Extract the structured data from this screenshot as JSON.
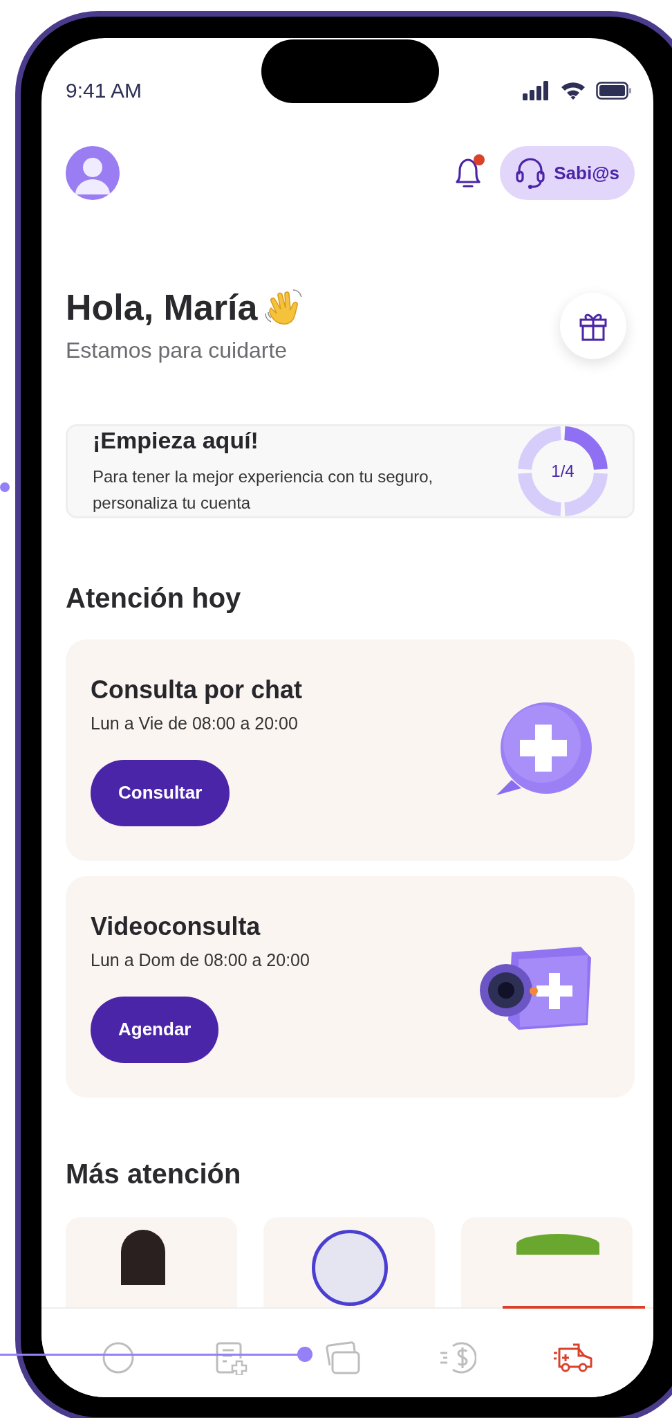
{
  "status_bar": {
    "time": "9:41 AM"
  },
  "header": {
    "notifications": {
      "unread": true
    },
    "support_button": {
      "label": "Sabi@s"
    }
  },
  "greeting": {
    "title": "Hola, María",
    "subtitle": "Estamos para cuidarte"
  },
  "onboarding_card": {
    "title": "¡Empieza aquí!",
    "text": "Para tener la mejor experiencia con tu seguro, personaliza tu cuenta",
    "progress": {
      "label": "1/4",
      "level": 0.25
    }
  },
  "today_section": {
    "title": "Atención hoy",
    "cards": [
      {
        "kind": "chat",
        "title": "Consulta por chat",
        "hours": "Lun a Vie de 08:00 a 20:00",
        "button": "Consultar"
      },
      {
        "kind": "video",
        "title": "Videoconsulta",
        "hours": "Lun a Dom de 08:00 a 20:00",
        "button": "Agendar"
      }
    ]
  },
  "more_section": {
    "title": "Más atención",
    "cards": [
      {
        "kind": "person"
      },
      {
        "kind": "ring"
      },
      {
        "kind": "leaves"
      }
    ]
  },
  "bottom_nav": [
    {
      "kind": "circle",
      "selected": false
    },
    {
      "kind": "document",
      "selected": false
    },
    {
      "kind": "cards",
      "selected": false
    },
    {
      "kind": "money",
      "selected": false
    },
    {
      "kind": "ambulance",
      "selected": true
    }
  ]
}
